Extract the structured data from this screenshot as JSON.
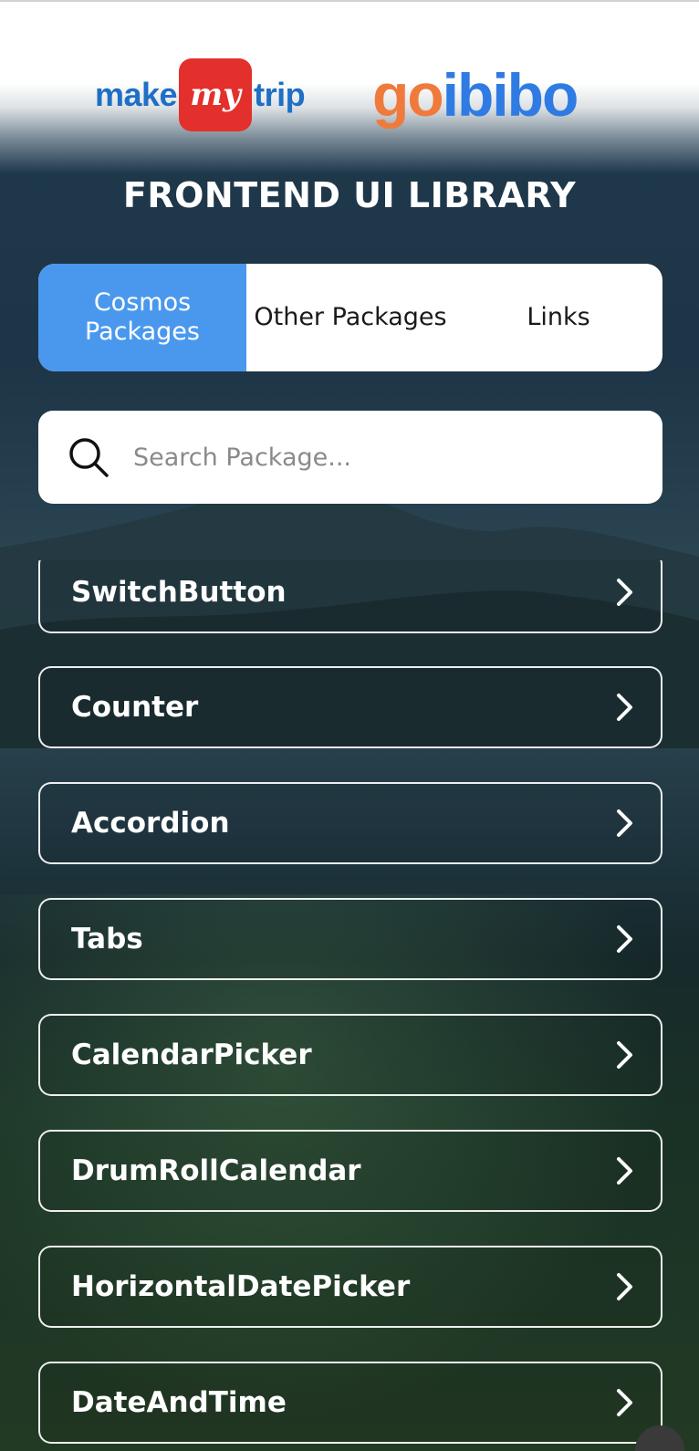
{
  "header": {
    "mmt_make": "make",
    "mmt_my": "my",
    "mmt_trip": "trip",
    "goibibo_go": "go",
    "goibibo_ibibo": "ibibo"
  },
  "title": "FRONTEND UI LIBRARY",
  "tabs": [
    {
      "label": "Cosmos\nPackages",
      "active": true
    },
    {
      "label": "Other Packages",
      "active": false
    },
    {
      "label": "Links",
      "active": false
    }
  ],
  "search": {
    "placeholder": "Search Package..."
  },
  "packages": [
    {
      "label": "SwitchButton"
    },
    {
      "label": "Counter"
    },
    {
      "label": "Accordion"
    },
    {
      "label": "Tabs"
    },
    {
      "label": "CalendarPicker"
    },
    {
      "label": "DrumRollCalendar"
    },
    {
      "label": "HorizontalDatePicker"
    },
    {
      "label": "DateAndTime"
    }
  ],
  "colors": {
    "active_tab": "#4a98ee",
    "mmt_blue": "#1f6fc5",
    "mmt_red": "#e3302c",
    "goibibo_orange": "#f07a3c",
    "goibibo_blue": "#2f7be3"
  }
}
